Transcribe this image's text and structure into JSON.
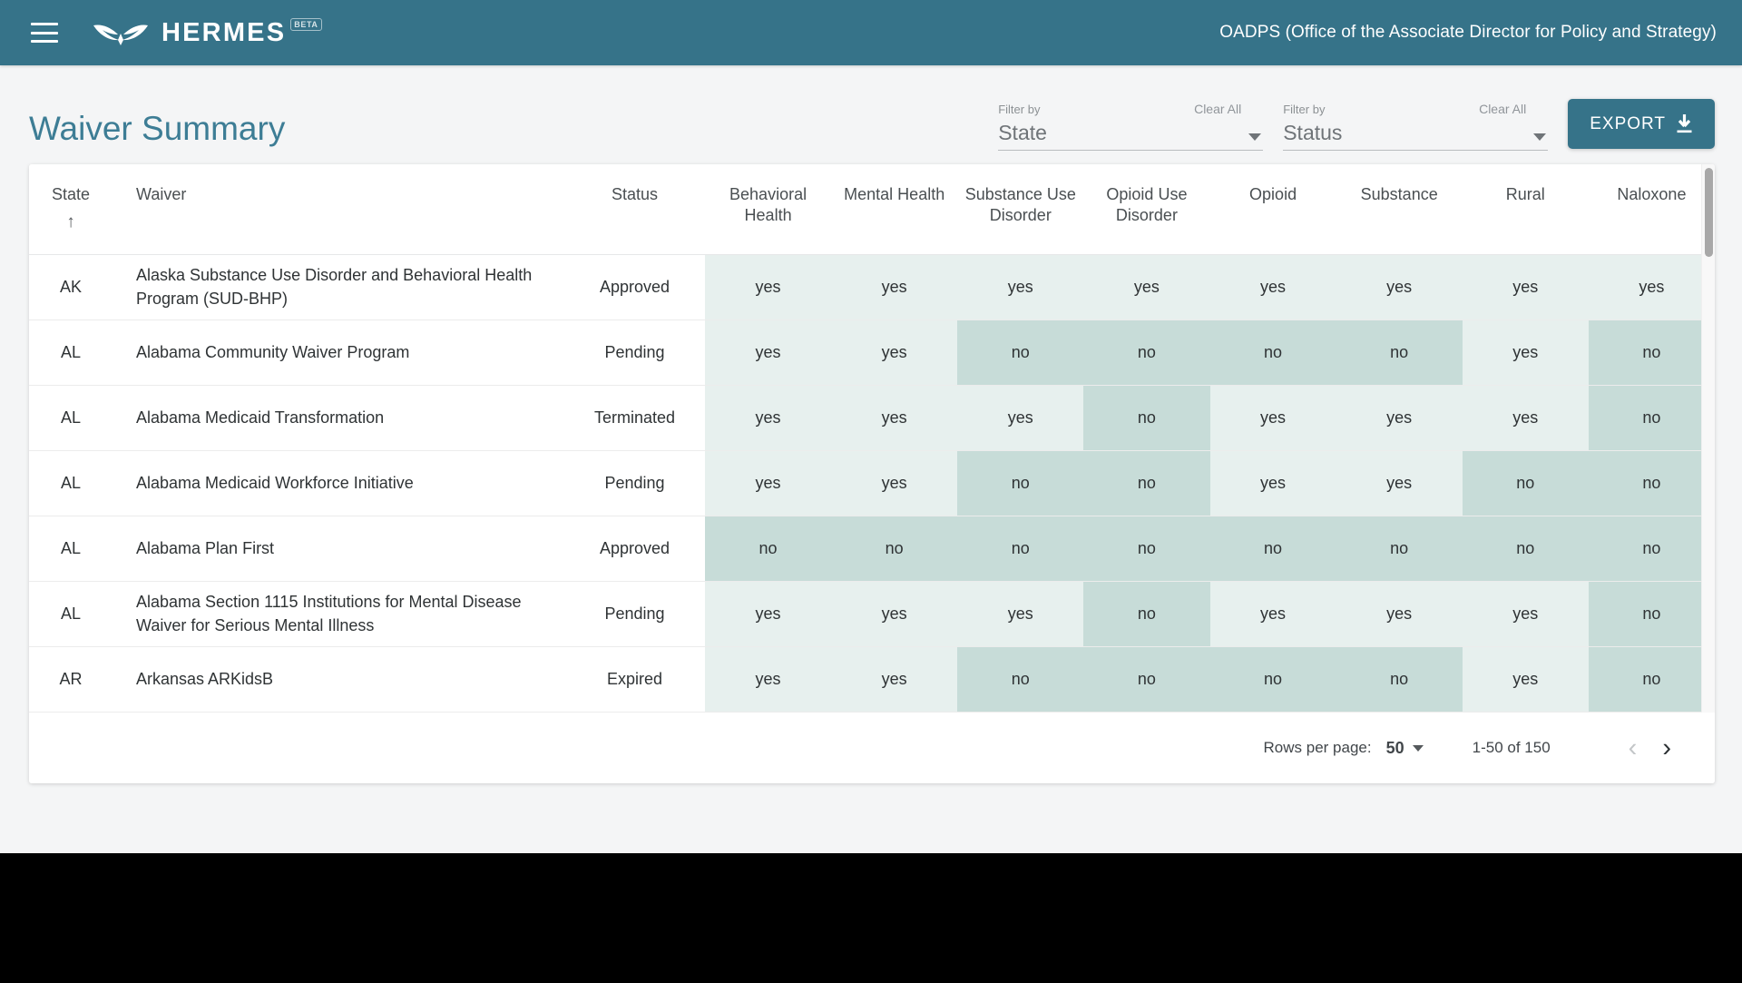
{
  "appbar": {
    "menu_icon": "hamburger-menu-icon",
    "logo_icon": "hermes-wings-logo",
    "brand": "HERMES",
    "badge": "BETA",
    "org": "OADPS (Office of the Associate Director for Policy and Strategy)",
    "bg_color": "#367389"
  },
  "page": {
    "title": "Waiver Summary",
    "title_color": "#3d7d95"
  },
  "filters": [
    {
      "label": "Filter by",
      "value": "State",
      "clear": "Clear All"
    },
    {
      "label": "Filter by",
      "value": "Status",
      "clear": "Clear All"
    }
  ],
  "export": {
    "label": "EXPORT",
    "icon": "download-icon",
    "bg_color": "#367389"
  },
  "table": {
    "sort_column": "State",
    "sort_direction_icon": "arrow-up-icon",
    "columns": [
      "State",
      "Waiver",
      "Status",
      "Behavioral Health",
      "Mental Health",
      "Substance Use Disorder",
      "Opioid Use Disorder",
      "Opioid",
      "Substance",
      "Rural",
      "Naloxone"
    ],
    "rows": [
      {
        "state": "AK",
        "waiver": "Alaska Substance Use Disorder and Behavioral Health Program (SUD-BHP)",
        "status": "Approved",
        "metrics": [
          "yes",
          "yes",
          "yes",
          "yes",
          "yes",
          "yes",
          "yes",
          "yes"
        ]
      },
      {
        "state": "AL",
        "waiver": "Alabama Community Waiver Program",
        "status": "Pending",
        "metrics": [
          "yes",
          "yes",
          "no",
          "no",
          "no",
          "no",
          "yes",
          "no"
        ]
      },
      {
        "state": "AL",
        "waiver": "Alabama Medicaid Transformation",
        "status": "Terminated",
        "metrics": [
          "yes",
          "yes",
          "yes",
          "no",
          "yes",
          "yes",
          "yes",
          "no"
        ]
      },
      {
        "state": "AL",
        "waiver": "Alabama Medicaid Workforce Initiative",
        "status": "Pending",
        "metrics": [
          "yes",
          "yes",
          "no",
          "no",
          "yes",
          "yes",
          "no",
          "no"
        ]
      },
      {
        "state": "AL",
        "waiver": "Alabama Plan First",
        "status": "Approved",
        "metrics": [
          "no",
          "no",
          "no",
          "no",
          "no",
          "no",
          "no",
          "no"
        ]
      },
      {
        "state": "AL",
        "waiver": "Alabama Section 1115 Institutions for Mental Disease Waiver for Serious Mental Illness",
        "status": "Pending",
        "metrics": [
          "yes",
          "yes",
          "yes",
          "no",
          "yes",
          "yes",
          "yes",
          "no"
        ]
      },
      {
        "state": "AR",
        "waiver": "Arkansas ARKidsB",
        "status": "Expired",
        "metrics": [
          "yes",
          "yes",
          "no",
          "no",
          "no",
          "no",
          "yes",
          "no"
        ]
      }
    ],
    "cell_colors": {
      "yes": "#e7f0ee",
      "no": "#c7dcd8"
    }
  },
  "pagination": {
    "rows_per_page_label": "Rows per page:",
    "rows_per_page_value": "50",
    "range": "1-50 of 150",
    "prev_icon": "chevron-left-icon",
    "next_icon": "chevron-right-icon"
  }
}
